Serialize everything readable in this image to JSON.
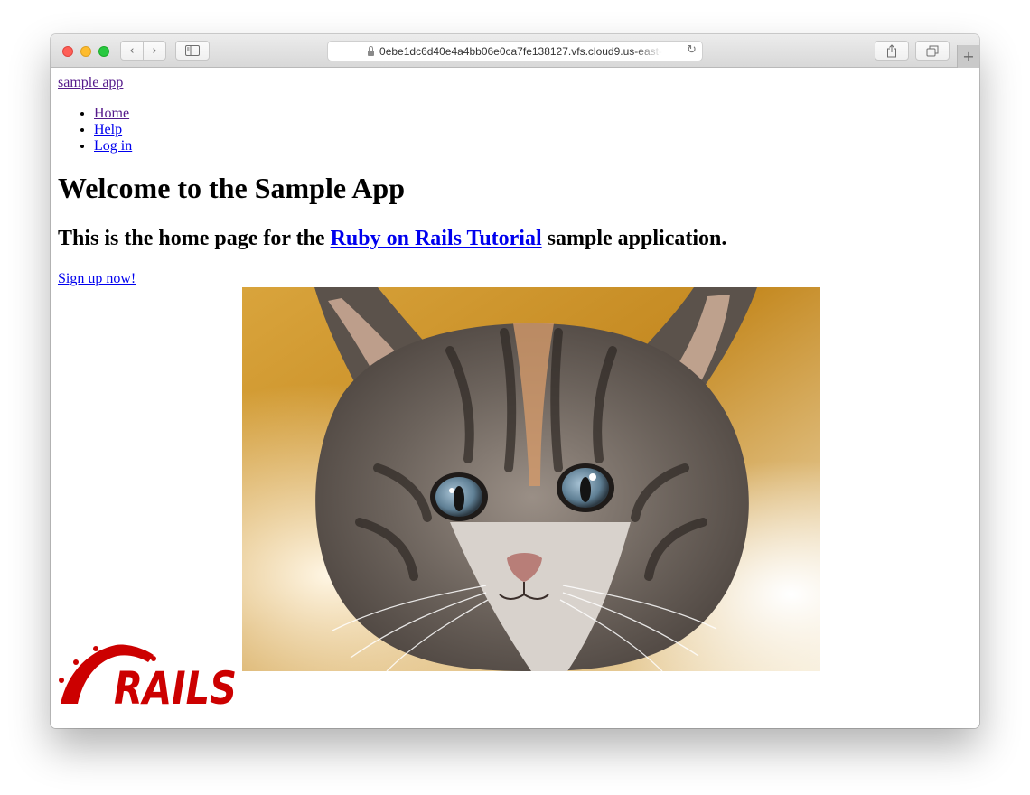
{
  "browser": {
    "url": "0ebe1dc6d40e4a4bb06e0ca7fe138127.vfs.cloud9.us-east-",
    "back_glyph": "‹",
    "forward_glyph": "›",
    "newtab_glyph": "+",
    "reload_glyph": "↻"
  },
  "header": {
    "logo_text": "sample app"
  },
  "nav": {
    "items": [
      {
        "label": "Home"
      },
      {
        "label": "Help"
      },
      {
        "label": "Log in"
      }
    ]
  },
  "main": {
    "title": "Welcome to the Sample App",
    "subtitle_before": "This is the home page for the ",
    "subtitle_link": "Ruby on Rails Tutorial",
    "subtitle_after": " sample application.",
    "signup_label": "Sign up now!"
  },
  "images": {
    "rails_logo_text": "RAILS",
    "kitten": "kitten photo"
  },
  "colors": {
    "link": "#0000ee",
    "visited_link": "#551a8b",
    "rails_red": "#cc0000"
  }
}
